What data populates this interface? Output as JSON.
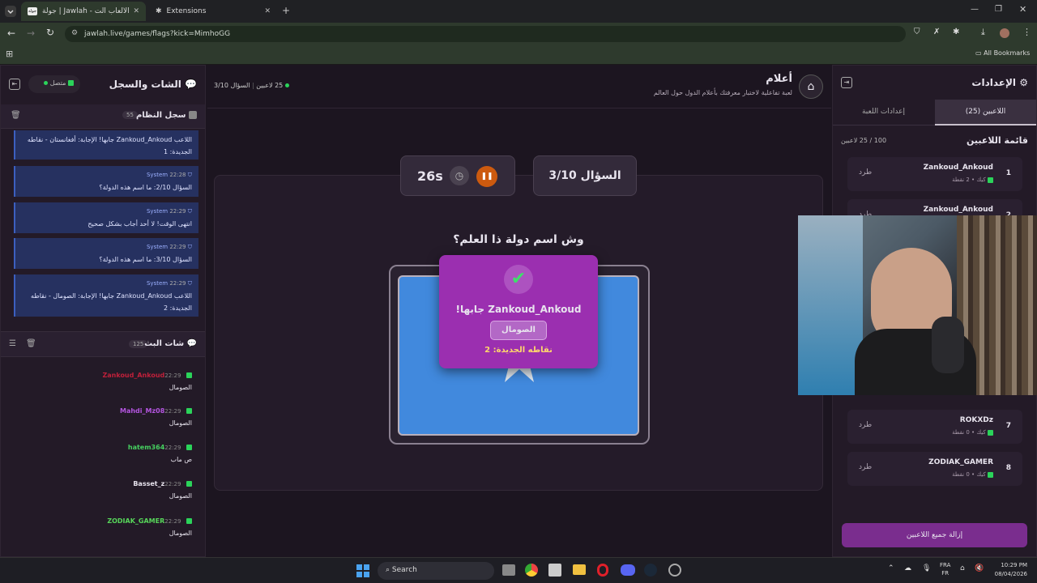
{
  "browser": {
    "tabs": [
      {
        "title": "جولة | Jawlah - منصة الألعاب الت..."
      },
      {
        "title": "Extensions"
      }
    ],
    "url": "jawlah.live/games/flags?kick=MimhoGG",
    "bookmarks_label": "All Bookmarks"
  },
  "left": {
    "title": "الشات والسجل",
    "status": "متصل",
    "syslog": {
      "title": "سجل النظام",
      "count": "55"
    },
    "log": [
      {
        "sender": "",
        "time": "",
        "text": "اللاعب Zankoud_Ankoud جابها! الإجابة: أفغانستان - نقاطه الجديدة: 1"
      },
      {
        "sender": "System",
        "time": "22:28",
        "text": "السؤال 2/10: ما اسم هذه الدولة؟"
      },
      {
        "sender": "System",
        "time": "22:29",
        "text": "انتهى الوقت! لا أحد أجاب بشكل صحيح"
      },
      {
        "sender": "System",
        "time": "22:29",
        "text": "السؤال 3/10: ما اسم هذه الدولة؟"
      },
      {
        "sender": "System",
        "time": "22:29",
        "text": "اللاعب Zankoud_Ankoud جابها! الإجابة: الصومال - نقاطه الجديدة: 2"
      }
    ],
    "stream": {
      "title": "شات البث",
      "count": "125"
    },
    "chat": [
      {
        "user": "Zankoud_Ankoud",
        "color": "#c0203a",
        "time": "22:29",
        "text": "الصومال"
      },
      {
        "user": "Mahdi_Mz08",
        "color": "#b455e0",
        "time": "22:29",
        "text": "الصومال"
      },
      {
        "user": "hatem364",
        "color": "#46d160",
        "time": "22:29",
        "text": "ص ماب"
      },
      {
        "user": "Basset_z",
        "color": "#e8e4ee",
        "time": "22:29",
        "text": "الصومال"
      },
      {
        "user": "ZODIAK_GAMER",
        "color": "#57d65a",
        "time": "22:29",
        "text": "الصومال"
      }
    ]
  },
  "center": {
    "game_title": "أعلام",
    "game_desc": "لعبة تفاعلية لاختبار معرفتك بأعلام الدول حول العالم",
    "players_count": "25 لاعبين",
    "question_progress": "السؤال 3/10",
    "question_box": "السؤال 3/10",
    "timer": "26s",
    "prompt": "وش اسم دولة ذا العلم؟",
    "popup": {
      "winner": "Zankoud_Ankoud جابها!",
      "answer": "الصومال",
      "points": "نقاطه الجديدة: 2"
    },
    "colors": {
      "flag": "#4189dd",
      "popup": "#9b2fb0",
      "accent": "#cc5a0f"
    }
  },
  "right": {
    "title": "الإعدادات",
    "tabs": [
      {
        "label": "اللاعبين (25)"
      },
      {
        "label": "إعدادات اللعبة"
      }
    ],
    "list_title": "قائمة اللاعبين",
    "capacity": "100 / 25 لاعبين",
    "players": [
      {
        "rank": "1",
        "name": "Zankoud_Ankoud",
        "sub": "كيك • 2 نقطة",
        "kick": "طرد"
      },
      {
        "rank": "2",
        "name": "Zankoud_Ankoud",
        "sub": "",
        "kick": "طرد"
      },
      {
        "rank": "7",
        "name": "ROKXDz",
        "sub": "كيك • 0 نقطة",
        "kick": "طرد"
      },
      {
        "rank": "8",
        "name": "ZODIAK_GAMER",
        "sub": "كيك • 0 نقطة",
        "kick": "طرد"
      }
    ],
    "remove_all": "إزالة جميع اللاعبين"
  },
  "taskbar": {
    "search": "Search",
    "lang1": "FRA",
    "lang2": "FR",
    "time": "10:29 PM",
    "date": "08/04/2026"
  }
}
